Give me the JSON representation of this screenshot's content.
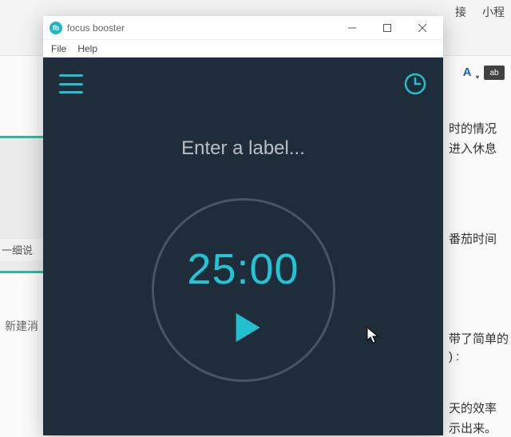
{
  "background": {
    "left_block_text": "一细说",
    "left_small_text": "新建消",
    "top_right_link1": "接",
    "top_right_link2": "小程",
    "right_texts": [
      "时的情况",
      "进入休息",
      "番茄时间",
      "带了简单的",
      ")  :",
      "天的效率",
      "示出来。"
    ]
  },
  "window": {
    "title": "focus booster",
    "app_icon_text": "fb",
    "menu": {
      "file": "File",
      "help": "Help"
    }
  },
  "app": {
    "label_placeholder": "Enter a label...",
    "timer_display": "25:00"
  }
}
